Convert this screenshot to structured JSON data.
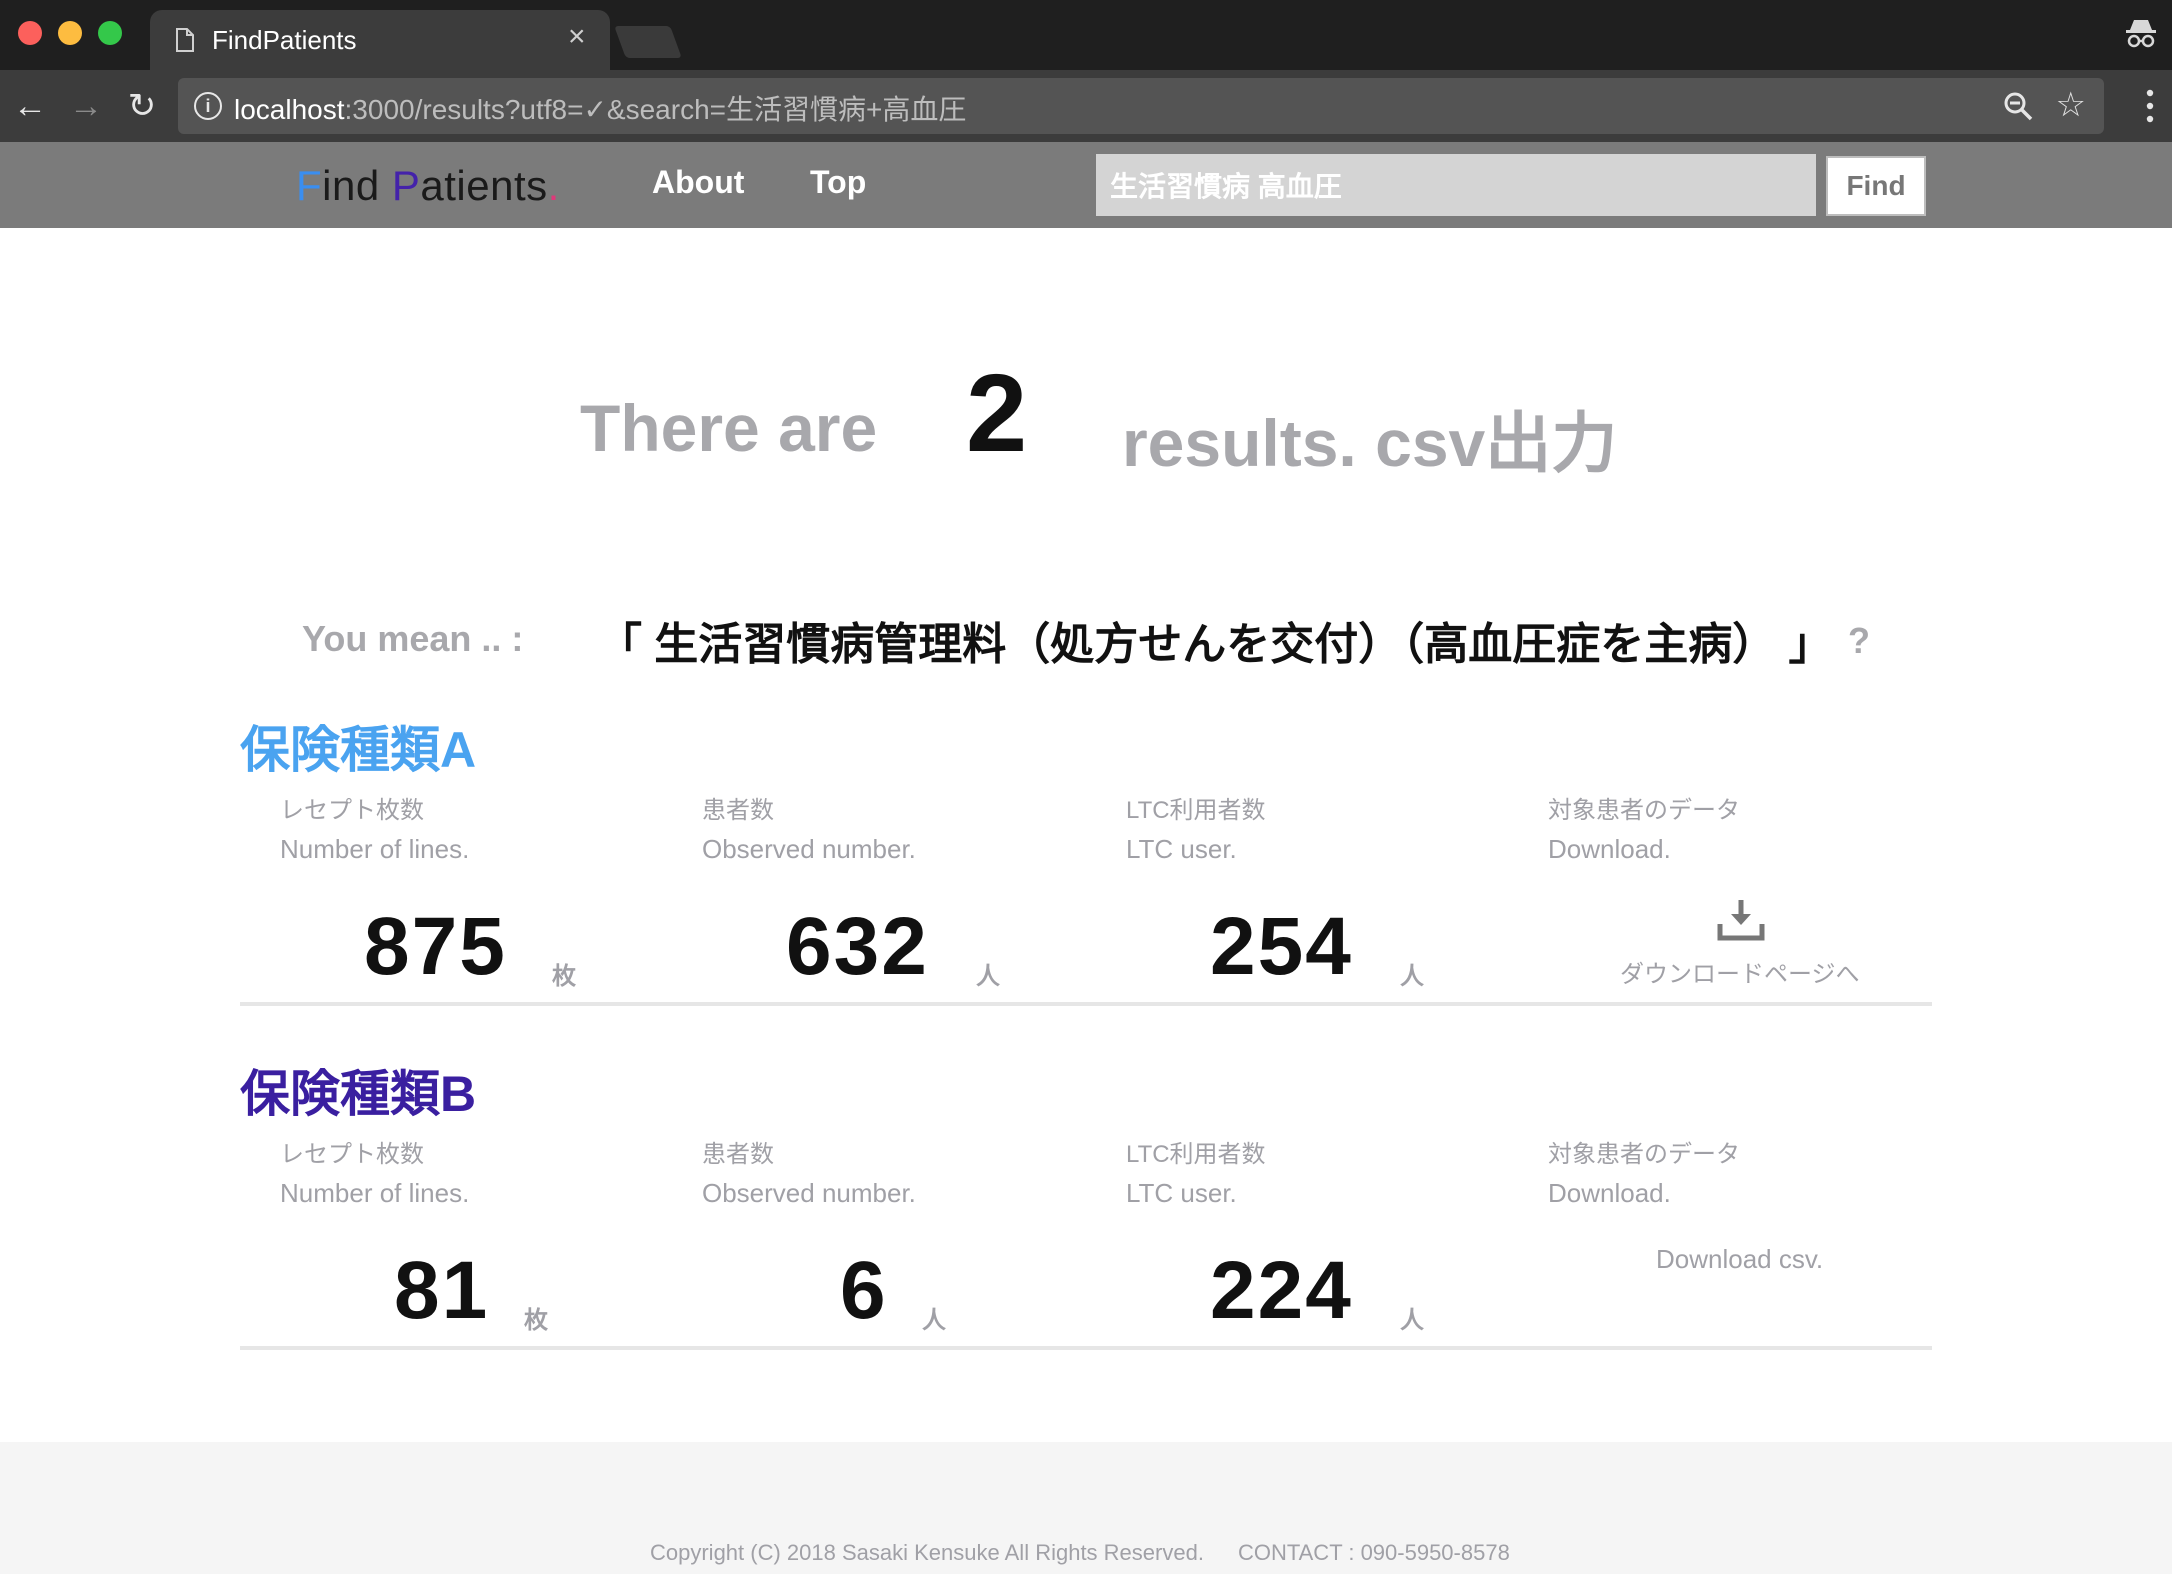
{
  "browser": {
    "tab_title": "FindPatients",
    "url_host": "localhost",
    "url_rest": ":3000/results?utf8=✓&search=生活習慣病+高血圧"
  },
  "nav": {
    "logo_f": "F",
    "logo_ind": "ind ",
    "logo_p": "P",
    "logo_atients": "atients",
    "logo_dot": ".",
    "about": "About",
    "top": "Top",
    "search_value": "生活習慣病 高血圧",
    "find_label": "Find"
  },
  "summary": {
    "pre": "There are",
    "count": "2",
    "post": "results. csv出力"
  },
  "suggestion": {
    "label": "You mean .. :",
    "text": "「 生活習慣病管理料（処方せんを交付）（高血圧症を主病） 」",
    "qmark": "?"
  },
  "columns": {
    "lines_jp": "レセプト枚数",
    "lines_en": "Number of lines.",
    "observed_jp": "患者数",
    "observed_en": "Observed number.",
    "ltc_jp": "LTC利用者数",
    "ltc_en": "LTC user.",
    "download_jp": "対象患者のデータ",
    "download_en": "Download."
  },
  "sections": [
    {
      "title": "保険種類A",
      "lines": "875",
      "lines_unit": "枚",
      "observed": "632",
      "observed_unit": "人",
      "ltc": "254",
      "ltc_unit": "人",
      "download_text": "ダウンロードページへ"
    },
    {
      "title": "保険種類B",
      "lines": "81",
      "lines_unit": "枚",
      "observed": "6",
      "observed_unit": "人",
      "ltc": "224",
      "ltc_unit": "人",
      "download_text": "Download csv."
    }
  ],
  "footer": {
    "copyright": "Copyright (C) 2018 Sasaki Kensuke All Rights Reserved.",
    "contact": "CONTACT : 090-5950-8578"
  }
}
